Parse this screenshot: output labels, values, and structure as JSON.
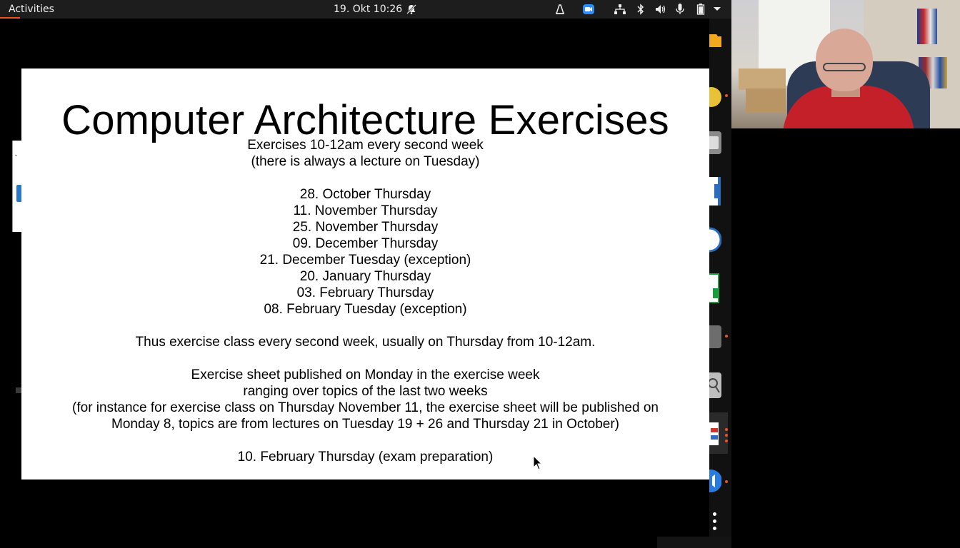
{
  "topbar": {
    "activities_label": "Activities",
    "clock": "19. Okt  10:26",
    "icons": [
      "notifications-off-icon",
      "wacom-tablet-icon",
      "zoom-icon",
      "network-icon",
      "bluetooth-icon",
      "volume-icon",
      "microphone-icon",
      "battery-icon",
      "system-menu-chevron-icon"
    ]
  },
  "slide": {
    "title": "Computer Architecture Exercises",
    "lines": [
      "Exercises 10-12am every second week",
      "(there is always a lecture on Tuesday)",
      "",
      "28. October Thursday",
      "11. November Thursday",
      "25. November Thursday",
      "09. December Thursday",
      "21. December Tuesday (exception)",
      "20. January Thursday",
      "03. February Thursday",
      "08. February Tuesday (exception)",
      "",
      "Thus exercise class every second week, usually on Thursday from 10-12am.",
      "",
      "Exercise sheet published on Monday in the exercise week",
      "ranging over topics of the last two weeks",
      "(for instance for exercise class on Thursday November 11, the exercise sheet will be published on",
      "Monday 8, topics are from lectures on Tuesday 19 + 26 and Thursday 21 in October)",
      "",
      "10. February Thursday (exam preparation)"
    ]
  },
  "dock": {
    "items": [
      "files-icon",
      "zoom-app-icon",
      "notes-icon",
      "document-viewer-icon",
      "calc-spreadsheet-icon",
      "window-icon",
      "magnifier-icon",
      "impress-presentation-icon",
      "speaker-app-icon"
    ],
    "show_apps": "show-applications-icon"
  },
  "webcam": {
    "name": "participant-video"
  },
  "colors": {
    "accent": "#e95420",
    "topbar": "#1d1d1d",
    "slide_bg": "#ffffff"
  }
}
